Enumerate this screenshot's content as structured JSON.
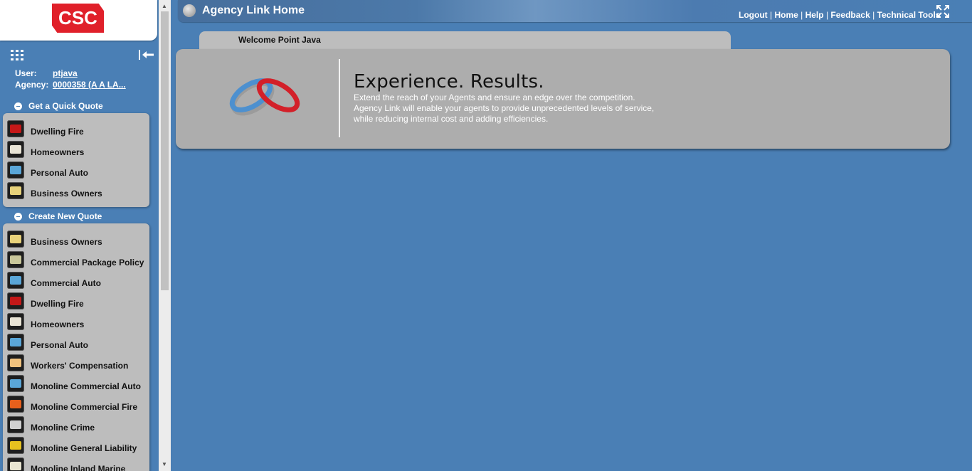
{
  "logo": {
    "text": "CSC"
  },
  "user": {
    "user_label": "User:",
    "user_value": "ptjava",
    "agency_label": "Agency:",
    "agency_value": "0000358 (A A LA..."
  },
  "quick_quote": {
    "heading": "Get a Quick Quote",
    "items": [
      {
        "label": "Dwelling Fire",
        "icon": "dwelling-fire-icon",
        "color": "#c41818"
      },
      {
        "label": "Homeowners",
        "icon": "homeowners-icon",
        "color": "#e9e4d6"
      },
      {
        "label": "Personal Auto",
        "icon": "personal-auto-icon",
        "color": "#5aa6d8"
      },
      {
        "label": "Business Owners",
        "icon": "business-owners-icon",
        "color": "#e8d27a"
      }
    ]
  },
  "new_quote": {
    "heading": "Create New Quote",
    "items": [
      {
        "label": "Business Owners",
        "icon": "business-owners-icon",
        "color": "#e8d27a"
      },
      {
        "label": "Commercial Package Policy",
        "icon": "commercial-package-icon",
        "color": "#c9c79a"
      },
      {
        "label": "Commercial Auto",
        "icon": "commercial-auto-icon",
        "color": "#5aa6d8"
      },
      {
        "label": "Dwelling Fire",
        "icon": "dwelling-fire-icon",
        "color": "#c41818"
      },
      {
        "label": "Homeowners",
        "icon": "homeowners-icon",
        "color": "#e9e4d6"
      },
      {
        "label": "Personal Auto",
        "icon": "personal-auto-icon",
        "color": "#5aa6d8"
      },
      {
        "label": "Workers' Compensation",
        "icon": "workers-comp-icon",
        "color": "#f1c27d"
      },
      {
        "label": "Monoline Commercial Auto",
        "icon": "monoline-commercial-auto-icon",
        "color": "#5aa6d8"
      },
      {
        "label": "Monoline Commercial Fire",
        "icon": "monoline-commercial-fire-icon",
        "color": "#e8601c"
      },
      {
        "label": "Monoline Crime",
        "icon": "monoline-crime-icon",
        "color": "#d0d0d0"
      },
      {
        "label": "Monoline General Liability",
        "icon": "monoline-general-liability-icon",
        "color": "#e6c21f"
      },
      {
        "label": "Monoline Inland Marine",
        "icon": "monoline-inland-marine-icon",
        "color": "#e8e4d0"
      }
    ]
  },
  "header": {
    "title": "Agency Link Home",
    "links": [
      "Logout",
      "Home",
      "Help",
      "Feedback",
      "Technical Tools"
    ]
  },
  "welcome": {
    "text": "Welcome Point Java"
  },
  "banner": {
    "headline": "Experience. Results.",
    "lines": [
      "Extend the reach of your Agents and ensure an edge over the competition.",
      "Agency Link will enable your agents to provide unprecedented levels of service,",
      "while reducing internal cost and adding efficiencies."
    ]
  }
}
